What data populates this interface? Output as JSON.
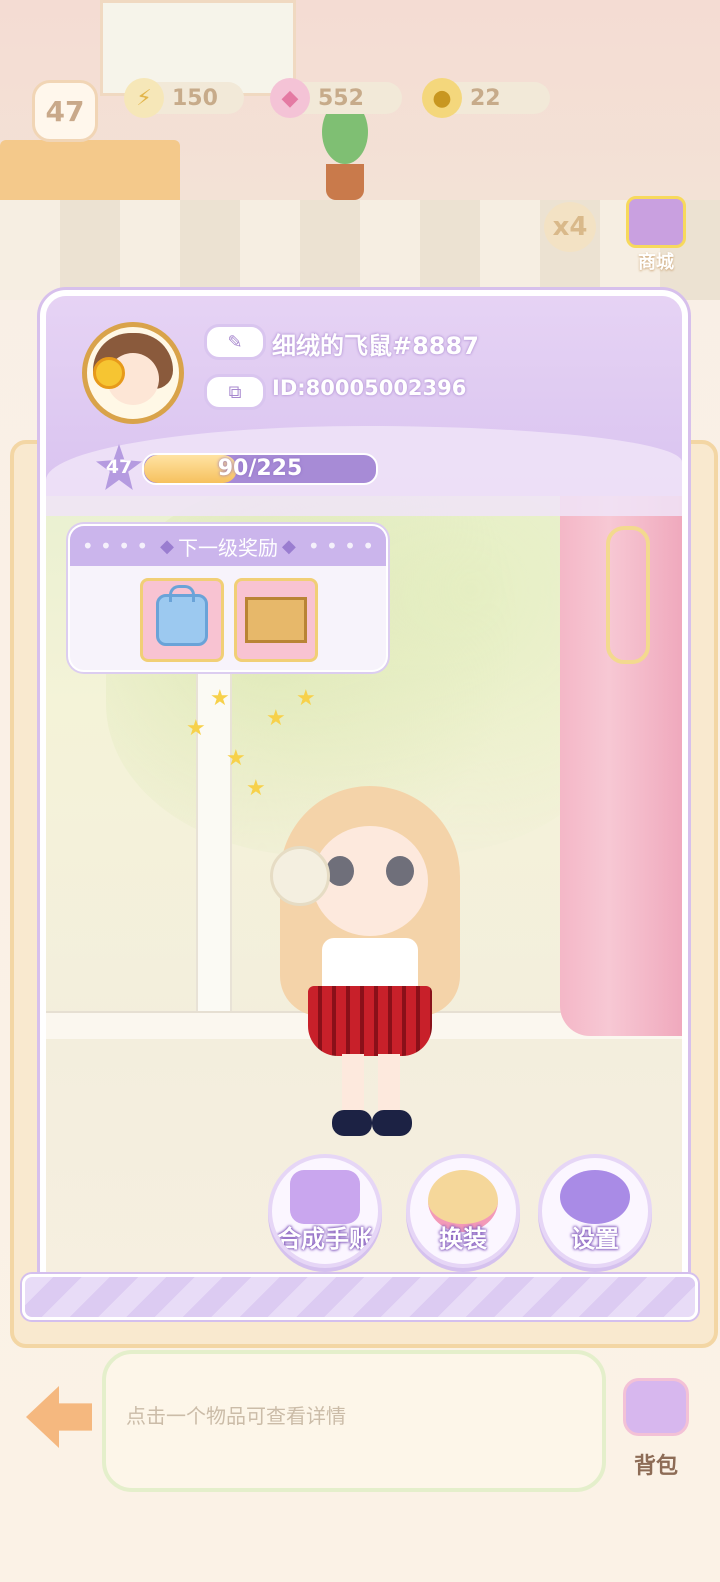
{
  "hud": {
    "player_level": "47",
    "energy": "150",
    "gems": "552",
    "coins": "22",
    "multiplier": "x4",
    "shop_label": "商城"
  },
  "profile": {
    "nickname": "细绒的飞鼠#8887",
    "uid": "ID:80005002396",
    "level": "47",
    "xp_text": "90/225",
    "xp_current": 90,
    "xp_max": 225
  },
  "rewards": {
    "title": "下一级奖励",
    "items": [
      {
        "icon": "blue-bag-icon"
      },
      {
        "icon": "cardboard-box-icon"
      }
    ]
  },
  "actions": {
    "merge_journal": "合成手账",
    "dress_up": "换装",
    "settings": "设置"
  },
  "bottom": {
    "hint": "点击一个物品可查看详情",
    "bag_label": "背包"
  },
  "colors": {
    "panel_purple": "#d9c3f0",
    "xp_fill": "#f6c15e",
    "curtain_pink": "#f4b7c7"
  }
}
